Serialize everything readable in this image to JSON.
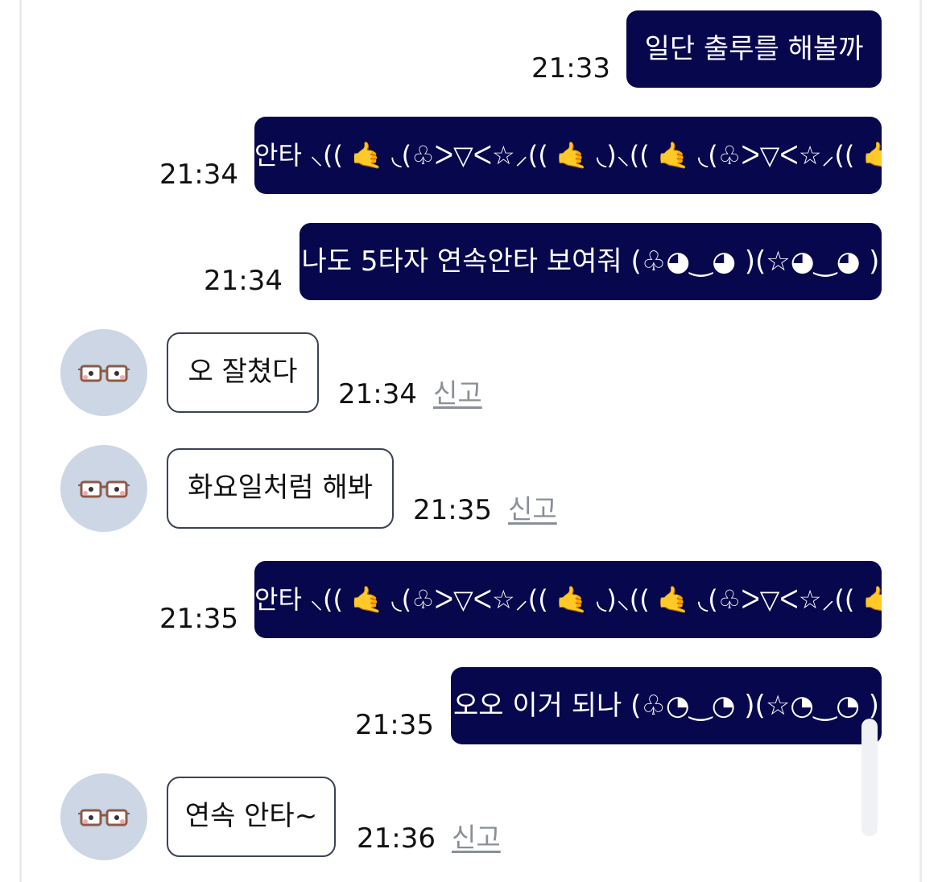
{
  "messages": [
    {
      "direction": "out",
      "text": "일단 출루를 해볼까",
      "time": "21:33"
    },
    {
      "direction": "out",
      "text": "안타 ⸜(( 🤙 ◟(♧ᐳ▽ᐸ☆⸝(( 🤙 ◟)⸜(( 🤙 ◟(♧ᐳ▽ᐸ☆⸝(( 🤙 ◟)",
      "time": "21:34"
    },
    {
      "direction": "out",
      "text": "나도 5타자 연속안타 보여줘 (♧◕‿◕ )(☆◕‿◕ )",
      "time": "21:34"
    },
    {
      "direction": "in",
      "text": "오 잘쳤다",
      "time": "21:34",
      "report": "신고"
    },
    {
      "direction": "in",
      "text": "화요일처럼 해봐",
      "time": "21:35",
      "report": "신고"
    },
    {
      "direction": "out",
      "text": "안타 ⸜(( 🤙 ◟(♧ᐳ▽ᐸ☆⸝(( 🤙 ◟)⸜(( 🤙 ◟(♧ᐳ▽ᐸ☆⸝(( 🤙 ◟)",
      "time": "21:35"
    },
    {
      "direction": "out",
      "text": "오오 이거 되나 (♧◔‿◔ )(☆◔‿◔ )",
      "time": "21:35"
    },
    {
      "direction": "in",
      "text": "연속 안타~",
      "time": "21:36",
      "report": "신고"
    }
  ],
  "colors": {
    "outgoing_bubble": "#07074d",
    "outgoing_text": "#ffffff",
    "incoming_border": "#3b4253",
    "avatar_bg": "#ccd6e4",
    "report_text": "#8a8f99"
  },
  "icons": {
    "avatar": "glasses-face-icon"
  }
}
